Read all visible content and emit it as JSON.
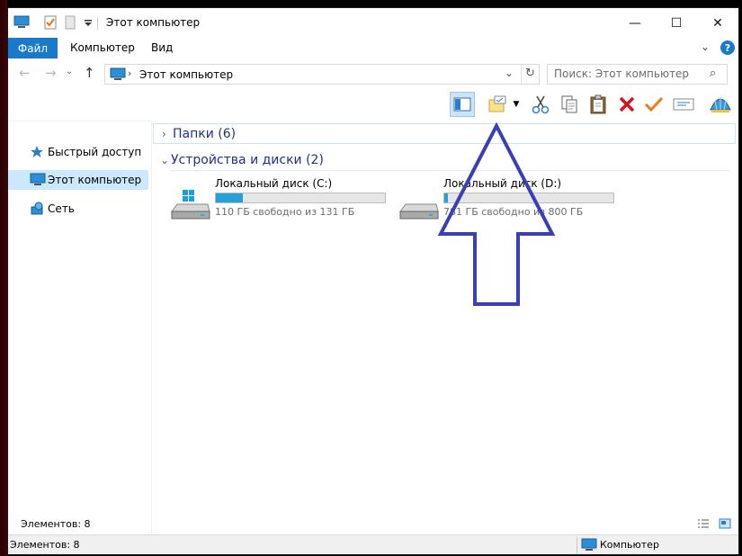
{
  "window": {
    "title": "Этот компьютер",
    "buttons": {
      "minimize": "—",
      "maximize": "☐",
      "close": "✕"
    }
  },
  "ribbon": {
    "tabs": [
      {
        "label": "Файл",
        "active": true
      },
      {
        "label": "Компьютер"
      },
      {
        "label": "Вид"
      }
    ],
    "help": "?"
  },
  "address": {
    "path": "Этот компьютер",
    "search_placeholder": "Поиск: Этот компьютер"
  },
  "toolbar": {
    "icons": [
      "navigation-pane-icon",
      "new-folder-icon",
      "cut-icon",
      "copy-icon",
      "paste-icon",
      "delete-icon",
      "rename-icon",
      "properties-icon",
      "shell-icon"
    ]
  },
  "nav": {
    "items": [
      {
        "label": "Быстрый доступ",
        "icon": "star-icon"
      },
      {
        "label": "Этот компьютер",
        "icon": "computer-icon",
        "selected": true
      },
      {
        "label": "Сеть",
        "icon": "network-icon"
      }
    ]
  },
  "content": {
    "groups": [
      {
        "label": "Папки (6)",
        "expanded": false
      },
      {
        "label": "Устройства и диски (2)",
        "expanded": true
      }
    ],
    "drives": [
      {
        "name": "Локальный диск (C:)",
        "free": "110 ГБ свободно из 131 ГБ",
        "used_fraction": 0.16
      },
      {
        "name": "Локальный диск (D:)",
        "free": "781 ГБ свободно из 800 ГБ",
        "used_fraction": 0.02
      }
    ]
  },
  "status": {
    "inner_count": "Элементов: 8",
    "outer_count": "Элементов: 8",
    "location": "Компьютер"
  },
  "colors": {
    "accent": "#1979ca",
    "drive_bar": "#26a0da",
    "selection": "#cce8ff",
    "arrow": "#3a3eb7"
  }
}
